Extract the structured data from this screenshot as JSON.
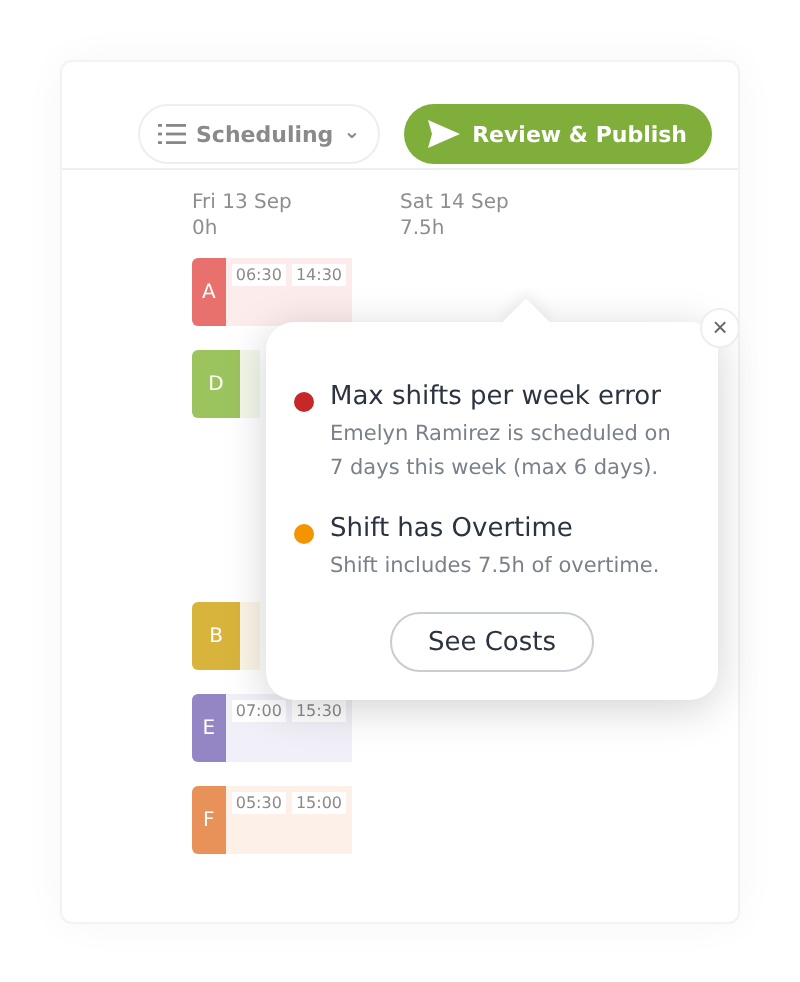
{
  "toolbar": {
    "view_menu": "Scheduling",
    "caret": "⌄",
    "publish_button": "Review & Publish"
  },
  "days": [
    {
      "label": "Fri 13 Sep",
      "hours": "0h"
    },
    {
      "label": "Sat 14 Sep",
      "hours": "7.5h"
    }
  ],
  "shifts": [
    {
      "initial": "A",
      "color": "#e8716e",
      "start": "06:30",
      "end": "14:30"
    },
    {
      "initial": "D",
      "color": "#9cc45e"
    },
    {
      "initial": "B",
      "color": "#d9b43c"
    },
    {
      "initial": "E",
      "color": "#9486c4",
      "start": "07:00",
      "end": "15:30"
    },
    {
      "initial": "F",
      "color": "#e8925a",
      "start": "05:30",
      "end": "15:00"
    }
  ],
  "popover": {
    "close": "×",
    "issues": [
      {
        "title": "Max shifts per week error",
        "detail": "Emelyn Ramirez is scheduled on 7 days this week (max 6 days).",
        "color": "#c62828"
      },
      {
        "title": "Shift has Overtime",
        "detail": "Shift includes 7.5h of overtime.",
        "color": "#f59300"
      }
    ],
    "button": "See Costs"
  }
}
